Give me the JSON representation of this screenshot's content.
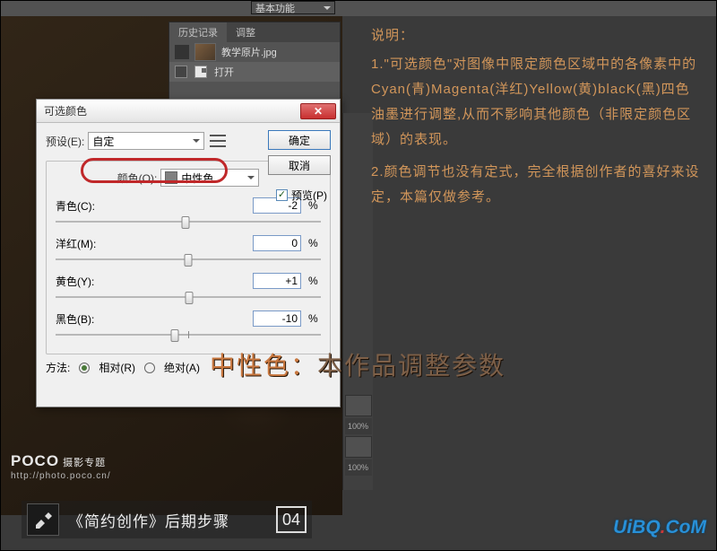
{
  "topbar": {
    "feature_label": "基本功能"
  },
  "history": {
    "tab_history": "历史记录",
    "tab_adjust": "调整",
    "snapshot_label": "教学原片.jpg",
    "step_open": "打开"
  },
  "dialog": {
    "title": "可选颜色",
    "preset_label": "预设(E):",
    "preset_value": "自定",
    "ok": "确定",
    "cancel": "取消",
    "preview": "预览(P)",
    "color_label": "颜色(O):",
    "color_value": "中性色",
    "cyan_label": "青色(C):",
    "cyan_value": "-2",
    "magenta_label": "洋红(M):",
    "magenta_value": "0",
    "yellow_label": "黄色(Y):",
    "yellow_value": "+1",
    "black_label": "黑色(B):",
    "black_value": "-10",
    "percent": "%",
    "method_label": "方法:",
    "relative": "相对(R)",
    "absolute": "绝对(A)"
  },
  "explain": {
    "heading": "说明：",
    "p1": "1.\"可选颜色\"对图像中限定颜色区域中的各像素中的Cyan(青)Magenta(洋红)Yellow(黄)blacK(黑)四色油墨进行调整,从而不影响其他颜色（非限定颜色区域）的表现。",
    "p2": "2.颜色调节也没有定式，完全根据创作者的喜好来设定，本篇仅做参考。"
  },
  "overlay": {
    "t1": "中性色：",
    "t2": "本作品调整参数"
  },
  "right": {
    "pct": "100%"
  },
  "poco": {
    "brand": "POCO",
    "topic": "摄影专题",
    "url": "http://photo.poco.cn/"
  },
  "bottom": {
    "title": "《简约创作》后期步骤",
    "step": "04"
  },
  "uibq": {
    "a": "UiBQ",
    "b": ".",
    "c": "CoM"
  }
}
